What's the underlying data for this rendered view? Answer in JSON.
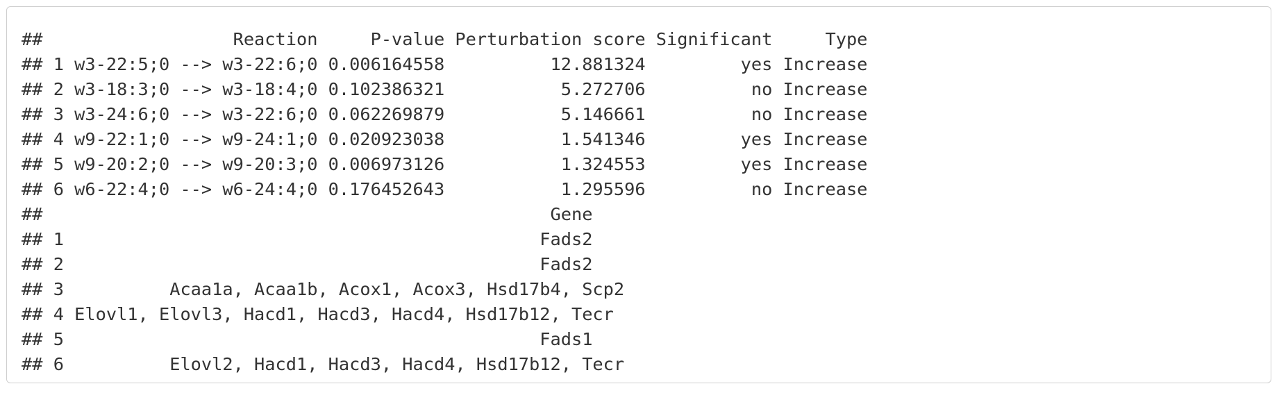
{
  "output": {
    "lines": [
      "##                  Reaction     P-value Perturbation score Significant     Type",
      "## 1 w3-22:5;0 --> w3-22:6;0 0.006164558          12.881324         yes Increase",
      "## 2 w3-18:3;0 --> w3-18:4;0 0.102386321           5.272706          no Increase",
      "## 3 w3-24:6;0 --> w3-22:6;0 0.062269879           5.146661          no Increase",
      "## 4 w9-22:1;0 --> w9-24:1;0 0.020923038           1.541346         yes Increase",
      "## 5 w9-20:2;0 --> w9-20:3;0 0.006973126           1.324553         yes Increase",
      "## 6 w6-22:4;0 --> w6-24:4;0 0.176452643           1.295596          no Increase",
      "##                                                Gene",
      "## 1                                             Fads2",
      "## 2                                             Fads2",
      "## 3          Acaa1a, Acaa1b, Acox1, Acox3, Hsd17b4, Scp2",
      "## 4 Elovl1, Elovl3, Hacd1, Hacd3, Hacd4, Hsd17b12, Tecr",
      "## 5                                             Fads1",
      "## 6          Elovl2, Hacd1, Hacd3, Hacd4, Hsd17b12, Tecr"
    ]
  }
}
